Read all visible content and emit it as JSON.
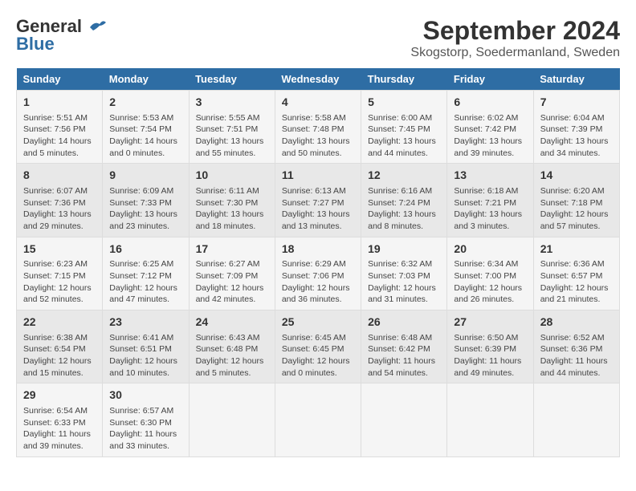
{
  "logo": {
    "line1": "General",
    "line2": "Blue"
  },
  "title": "September 2024",
  "subtitle": "Skogstorp, Soedermanland, Sweden",
  "headers": [
    "Sunday",
    "Monday",
    "Tuesday",
    "Wednesday",
    "Thursday",
    "Friday",
    "Saturday"
  ],
  "weeks": [
    [
      {
        "day": "1",
        "info": "Sunrise: 5:51 AM\nSunset: 7:56 PM\nDaylight: 14 hours\nand 5 minutes."
      },
      {
        "day": "2",
        "info": "Sunrise: 5:53 AM\nSunset: 7:54 PM\nDaylight: 14 hours\nand 0 minutes."
      },
      {
        "day": "3",
        "info": "Sunrise: 5:55 AM\nSunset: 7:51 PM\nDaylight: 13 hours\nand 55 minutes."
      },
      {
        "day": "4",
        "info": "Sunrise: 5:58 AM\nSunset: 7:48 PM\nDaylight: 13 hours\nand 50 minutes."
      },
      {
        "day": "5",
        "info": "Sunrise: 6:00 AM\nSunset: 7:45 PM\nDaylight: 13 hours\nand 44 minutes."
      },
      {
        "day": "6",
        "info": "Sunrise: 6:02 AM\nSunset: 7:42 PM\nDaylight: 13 hours\nand 39 minutes."
      },
      {
        "day": "7",
        "info": "Sunrise: 6:04 AM\nSunset: 7:39 PM\nDaylight: 13 hours\nand 34 minutes."
      }
    ],
    [
      {
        "day": "8",
        "info": "Sunrise: 6:07 AM\nSunset: 7:36 PM\nDaylight: 13 hours\nand 29 minutes."
      },
      {
        "day": "9",
        "info": "Sunrise: 6:09 AM\nSunset: 7:33 PM\nDaylight: 13 hours\nand 23 minutes."
      },
      {
        "day": "10",
        "info": "Sunrise: 6:11 AM\nSunset: 7:30 PM\nDaylight: 13 hours\nand 18 minutes."
      },
      {
        "day": "11",
        "info": "Sunrise: 6:13 AM\nSunset: 7:27 PM\nDaylight: 13 hours\nand 13 minutes."
      },
      {
        "day": "12",
        "info": "Sunrise: 6:16 AM\nSunset: 7:24 PM\nDaylight: 13 hours\nand 8 minutes."
      },
      {
        "day": "13",
        "info": "Sunrise: 6:18 AM\nSunset: 7:21 PM\nDaylight: 13 hours\nand 3 minutes."
      },
      {
        "day": "14",
        "info": "Sunrise: 6:20 AM\nSunset: 7:18 PM\nDaylight: 12 hours\nand 57 minutes."
      }
    ],
    [
      {
        "day": "15",
        "info": "Sunrise: 6:23 AM\nSunset: 7:15 PM\nDaylight: 12 hours\nand 52 minutes."
      },
      {
        "day": "16",
        "info": "Sunrise: 6:25 AM\nSunset: 7:12 PM\nDaylight: 12 hours\nand 47 minutes."
      },
      {
        "day": "17",
        "info": "Sunrise: 6:27 AM\nSunset: 7:09 PM\nDaylight: 12 hours\nand 42 minutes."
      },
      {
        "day": "18",
        "info": "Sunrise: 6:29 AM\nSunset: 7:06 PM\nDaylight: 12 hours\nand 36 minutes."
      },
      {
        "day": "19",
        "info": "Sunrise: 6:32 AM\nSunset: 7:03 PM\nDaylight: 12 hours\nand 31 minutes."
      },
      {
        "day": "20",
        "info": "Sunrise: 6:34 AM\nSunset: 7:00 PM\nDaylight: 12 hours\nand 26 minutes."
      },
      {
        "day": "21",
        "info": "Sunrise: 6:36 AM\nSunset: 6:57 PM\nDaylight: 12 hours\nand 21 minutes."
      }
    ],
    [
      {
        "day": "22",
        "info": "Sunrise: 6:38 AM\nSunset: 6:54 PM\nDaylight: 12 hours\nand 15 minutes."
      },
      {
        "day": "23",
        "info": "Sunrise: 6:41 AM\nSunset: 6:51 PM\nDaylight: 12 hours\nand 10 minutes."
      },
      {
        "day": "24",
        "info": "Sunrise: 6:43 AM\nSunset: 6:48 PM\nDaylight: 12 hours\nand 5 minutes."
      },
      {
        "day": "25",
        "info": "Sunrise: 6:45 AM\nSunset: 6:45 PM\nDaylight: 12 hours\nand 0 minutes."
      },
      {
        "day": "26",
        "info": "Sunrise: 6:48 AM\nSunset: 6:42 PM\nDaylight: 11 hours\nand 54 minutes."
      },
      {
        "day": "27",
        "info": "Sunrise: 6:50 AM\nSunset: 6:39 PM\nDaylight: 11 hours\nand 49 minutes."
      },
      {
        "day": "28",
        "info": "Sunrise: 6:52 AM\nSunset: 6:36 PM\nDaylight: 11 hours\nand 44 minutes."
      }
    ],
    [
      {
        "day": "29",
        "info": "Sunrise: 6:54 AM\nSunset: 6:33 PM\nDaylight: 11 hours\nand 39 minutes."
      },
      {
        "day": "30",
        "info": "Sunrise: 6:57 AM\nSunset: 6:30 PM\nDaylight: 11 hours\nand 33 minutes."
      },
      null,
      null,
      null,
      null,
      null
    ]
  ]
}
